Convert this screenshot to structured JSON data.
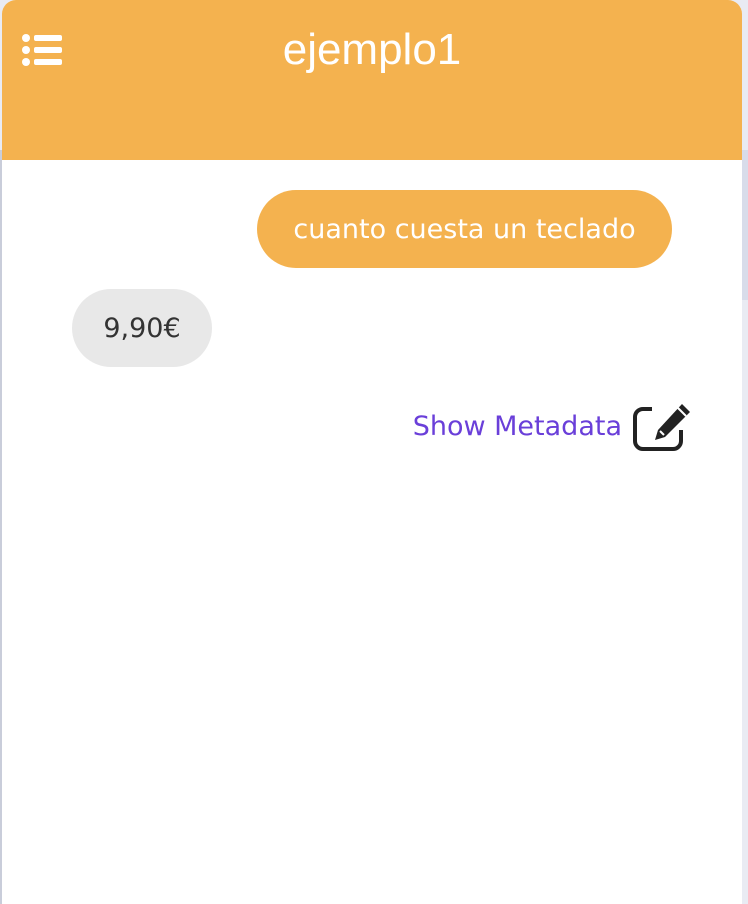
{
  "header": {
    "title": "ejemplo1",
    "menu_icon": "list-icon",
    "color": "#f4b24f"
  },
  "messages": [
    {
      "role": "user",
      "text": "cuanto cuesta un teclado",
      "color": "#f4b24f"
    },
    {
      "role": "bot",
      "text": "9,90€",
      "color": "#e8e8e8"
    }
  ],
  "metadata_link": {
    "label": "Show Metadata",
    "icon": "edit-icon",
    "color": "#6a3fd9"
  }
}
